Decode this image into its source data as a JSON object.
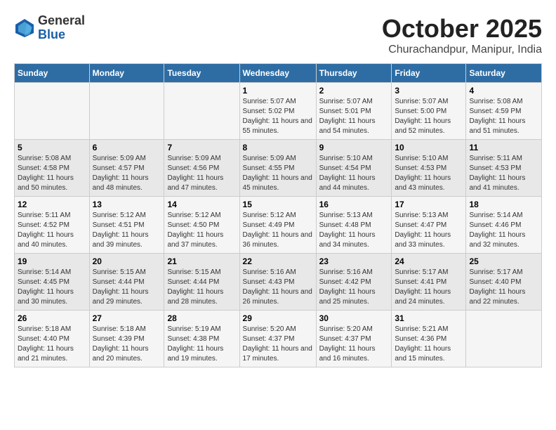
{
  "header": {
    "logo": {
      "line1": "General",
      "line2": "Blue"
    },
    "title": "October 2025",
    "subtitle": "Churachandpur, Manipur, India"
  },
  "columns": [
    "Sunday",
    "Monday",
    "Tuesday",
    "Wednesday",
    "Thursday",
    "Friday",
    "Saturday"
  ],
  "weeks": [
    [
      {
        "day": "",
        "sunrise": "",
        "sunset": "",
        "daylight": ""
      },
      {
        "day": "",
        "sunrise": "",
        "sunset": "",
        "daylight": ""
      },
      {
        "day": "",
        "sunrise": "",
        "sunset": "",
        "daylight": ""
      },
      {
        "day": "1",
        "sunrise": "Sunrise: 5:07 AM",
        "sunset": "Sunset: 5:02 PM",
        "daylight": "Daylight: 11 hours and 55 minutes."
      },
      {
        "day": "2",
        "sunrise": "Sunrise: 5:07 AM",
        "sunset": "Sunset: 5:01 PM",
        "daylight": "Daylight: 11 hours and 54 minutes."
      },
      {
        "day": "3",
        "sunrise": "Sunrise: 5:07 AM",
        "sunset": "Sunset: 5:00 PM",
        "daylight": "Daylight: 11 hours and 52 minutes."
      },
      {
        "day": "4",
        "sunrise": "Sunrise: 5:08 AM",
        "sunset": "Sunset: 4:59 PM",
        "daylight": "Daylight: 11 hours and 51 minutes."
      }
    ],
    [
      {
        "day": "5",
        "sunrise": "Sunrise: 5:08 AM",
        "sunset": "Sunset: 4:58 PM",
        "daylight": "Daylight: 11 hours and 50 minutes."
      },
      {
        "day": "6",
        "sunrise": "Sunrise: 5:09 AM",
        "sunset": "Sunset: 4:57 PM",
        "daylight": "Daylight: 11 hours and 48 minutes."
      },
      {
        "day": "7",
        "sunrise": "Sunrise: 5:09 AM",
        "sunset": "Sunset: 4:56 PM",
        "daylight": "Daylight: 11 hours and 47 minutes."
      },
      {
        "day": "8",
        "sunrise": "Sunrise: 5:09 AM",
        "sunset": "Sunset: 4:55 PM",
        "daylight": "Daylight: 11 hours and 45 minutes."
      },
      {
        "day": "9",
        "sunrise": "Sunrise: 5:10 AM",
        "sunset": "Sunset: 4:54 PM",
        "daylight": "Daylight: 11 hours and 44 minutes."
      },
      {
        "day": "10",
        "sunrise": "Sunrise: 5:10 AM",
        "sunset": "Sunset: 4:53 PM",
        "daylight": "Daylight: 11 hours and 43 minutes."
      },
      {
        "day": "11",
        "sunrise": "Sunrise: 5:11 AM",
        "sunset": "Sunset: 4:53 PM",
        "daylight": "Daylight: 11 hours and 41 minutes."
      }
    ],
    [
      {
        "day": "12",
        "sunrise": "Sunrise: 5:11 AM",
        "sunset": "Sunset: 4:52 PM",
        "daylight": "Daylight: 11 hours and 40 minutes."
      },
      {
        "day": "13",
        "sunrise": "Sunrise: 5:12 AM",
        "sunset": "Sunset: 4:51 PM",
        "daylight": "Daylight: 11 hours and 39 minutes."
      },
      {
        "day": "14",
        "sunrise": "Sunrise: 5:12 AM",
        "sunset": "Sunset: 4:50 PM",
        "daylight": "Daylight: 11 hours and 37 minutes."
      },
      {
        "day": "15",
        "sunrise": "Sunrise: 5:12 AM",
        "sunset": "Sunset: 4:49 PM",
        "daylight": "Daylight: 11 hours and 36 minutes."
      },
      {
        "day": "16",
        "sunrise": "Sunrise: 5:13 AM",
        "sunset": "Sunset: 4:48 PM",
        "daylight": "Daylight: 11 hours and 34 minutes."
      },
      {
        "day": "17",
        "sunrise": "Sunrise: 5:13 AM",
        "sunset": "Sunset: 4:47 PM",
        "daylight": "Daylight: 11 hours and 33 minutes."
      },
      {
        "day": "18",
        "sunrise": "Sunrise: 5:14 AM",
        "sunset": "Sunset: 4:46 PM",
        "daylight": "Daylight: 11 hours and 32 minutes."
      }
    ],
    [
      {
        "day": "19",
        "sunrise": "Sunrise: 5:14 AM",
        "sunset": "Sunset: 4:45 PM",
        "daylight": "Daylight: 11 hours and 30 minutes."
      },
      {
        "day": "20",
        "sunrise": "Sunrise: 5:15 AM",
        "sunset": "Sunset: 4:44 PM",
        "daylight": "Daylight: 11 hours and 29 minutes."
      },
      {
        "day": "21",
        "sunrise": "Sunrise: 5:15 AM",
        "sunset": "Sunset: 4:44 PM",
        "daylight": "Daylight: 11 hours and 28 minutes."
      },
      {
        "day": "22",
        "sunrise": "Sunrise: 5:16 AM",
        "sunset": "Sunset: 4:43 PM",
        "daylight": "Daylight: 11 hours and 26 minutes."
      },
      {
        "day": "23",
        "sunrise": "Sunrise: 5:16 AM",
        "sunset": "Sunset: 4:42 PM",
        "daylight": "Daylight: 11 hours and 25 minutes."
      },
      {
        "day": "24",
        "sunrise": "Sunrise: 5:17 AM",
        "sunset": "Sunset: 4:41 PM",
        "daylight": "Daylight: 11 hours and 24 minutes."
      },
      {
        "day": "25",
        "sunrise": "Sunrise: 5:17 AM",
        "sunset": "Sunset: 4:40 PM",
        "daylight": "Daylight: 11 hours and 22 minutes."
      }
    ],
    [
      {
        "day": "26",
        "sunrise": "Sunrise: 5:18 AM",
        "sunset": "Sunset: 4:40 PM",
        "daylight": "Daylight: 11 hours and 21 minutes."
      },
      {
        "day": "27",
        "sunrise": "Sunrise: 5:18 AM",
        "sunset": "Sunset: 4:39 PM",
        "daylight": "Daylight: 11 hours and 20 minutes."
      },
      {
        "day": "28",
        "sunrise": "Sunrise: 5:19 AM",
        "sunset": "Sunset: 4:38 PM",
        "daylight": "Daylight: 11 hours and 19 minutes."
      },
      {
        "day": "29",
        "sunrise": "Sunrise: 5:20 AM",
        "sunset": "Sunset: 4:37 PM",
        "daylight": "Daylight: 11 hours and 17 minutes."
      },
      {
        "day": "30",
        "sunrise": "Sunrise: 5:20 AM",
        "sunset": "Sunset: 4:37 PM",
        "daylight": "Daylight: 11 hours and 16 minutes."
      },
      {
        "day": "31",
        "sunrise": "Sunrise: 5:21 AM",
        "sunset": "Sunset: 4:36 PM",
        "daylight": "Daylight: 11 hours and 15 minutes."
      },
      {
        "day": "",
        "sunrise": "",
        "sunset": "",
        "daylight": ""
      }
    ]
  ]
}
